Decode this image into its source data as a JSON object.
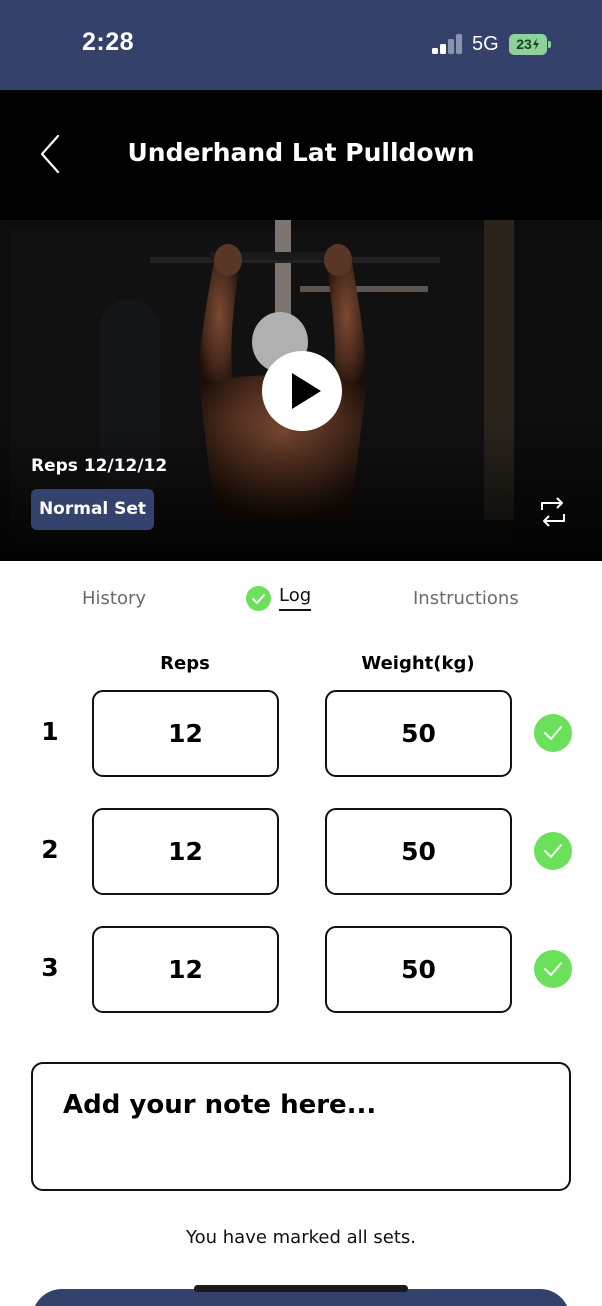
{
  "status_bar": {
    "time": "2:28",
    "network": "5G",
    "battery": "23"
  },
  "exercise": {
    "title": "Underhand Lat Pulldown",
    "reps_label": "Reps 12/12/12",
    "set_type": "Normal Set"
  },
  "tabs": {
    "history": "History",
    "log": "Log",
    "instructions": "Instructions",
    "active": "log"
  },
  "log": {
    "columns": {
      "reps": "Reps",
      "weight": "Weight(kg)"
    },
    "sets": [
      {
        "number": "1",
        "reps": "12",
        "weight": "50",
        "done": true
      },
      {
        "number": "2",
        "reps": "12",
        "weight": "50",
        "done": true
      },
      {
        "number": "3",
        "reps": "12",
        "weight": "50",
        "done": true
      }
    ]
  },
  "note": {
    "placeholder": "Add your note here..."
  },
  "status_message": "You have marked all sets.",
  "colors": {
    "brand_navy": "#33416b",
    "check_green": "#6be05a"
  }
}
